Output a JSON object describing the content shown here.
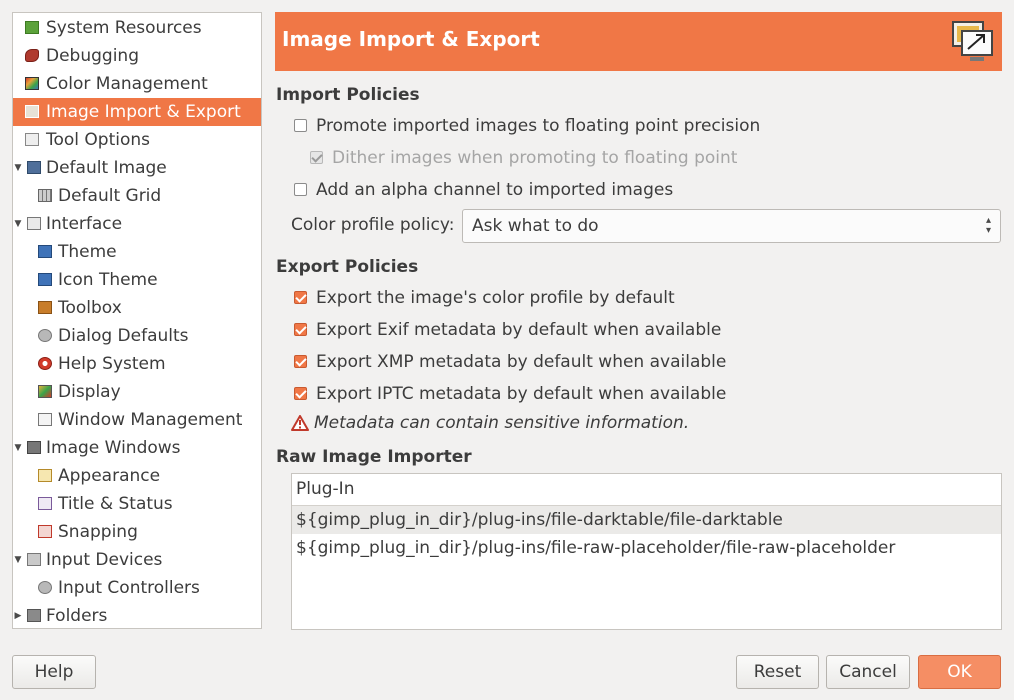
{
  "sidebar": {
    "items": [
      {
        "label": "System Resources",
        "icon": "system-resources-icon",
        "color": "#5ba23a"
      },
      {
        "label": "Debugging",
        "icon": "bug-icon",
        "color": "#b03a2e"
      },
      {
        "label": "Color Management",
        "icon": "color-management-icon",
        "color": "#e8a33b"
      },
      {
        "label": "Image Import & Export",
        "icon": "image-import-export-icon",
        "color": "#8a8a8a"
      },
      {
        "label": "Tool Options",
        "icon": "tool-options-icon",
        "color": "#9a9a9a"
      },
      {
        "label": "Default Image",
        "icon": "default-image-icon",
        "color": "#4f6f9a"
      },
      {
        "label": "Default Grid",
        "icon": "grid-icon",
        "color": "#7d7d7d"
      },
      {
        "label": "Interface",
        "icon": "interface-icon",
        "color": "#8a8a8a"
      },
      {
        "label": "Theme",
        "icon": "theme-icon",
        "color": "#3f73b8"
      },
      {
        "label": "Icon Theme",
        "icon": "icon-theme-icon",
        "color": "#3f73b8"
      },
      {
        "label": "Toolbox",
        "icon": "toolbox-icon",
        "color": "#c87d2a"
      },
      {
        "label": "Dialog Defaults",
        "icon": "dialog-defaults-icon",
        "color": "#9a9a9a"
      },
      {
        "label": "Help System",
        "icon": "lifebuoy-icon",
        "color": "#d23b2b"
      },
      {
        "label": "Display",
        "icon": "display-icon",
        "color": "#e3b23c"
      },
      {
        "label": "Window Management",
        "icon": "window-management-icon",
        "color": "#8a8a8a"
      },
      {
        "label": "Image Windows",
        "icon": "image-windows-icon",
        "color": "#777777"
      },
      {
        "label": "Appearance",
        "icon": "appearance-icon",
        "color": "#e3b23c"
      },
      {
        "label": "Title & Status",
        "icon": "title-status-icon",
        "color": "#7a5a9a"
      },
      {
        "label": "Snapping",
        "icon": "snapping-icon",
        "color": "#c0392b"
      },
      {
        "label": "Input Devices",
        "icon": "input-devices-icon",
        "color": "#8a8a8a"
      },
      {
        "label": "Input Controllers",
        "icon": "input-controllers-icon",
        "color": "#9a9a9a"
      },
      {
        "label": "Folders",
        "icon": "folders-icon",
        "color": "#6b6b6b"
      }
    ]
  },
  "header": {
    "title": "Image Import & Export",
    "icon": "import-export-icon"
  },
  "import": {
    "title": "Import Policies",
    "promote_label": "Promote imported images to floating point precision",
    "promote_checked": false,
    "dither_label": "Dither images when promoting to floating point",
    "dither_checked": true,
    "alpha_label": "Add an alpha channel to imported images",
    "alpha_checked": false,
    "profile_policy_label": "Color profile policy:",
    "profile_policy_value": "Ask what to do"
  },
  "export": {
    "title": "Export Policies",
    "options": [
      {
        "label": "Export the image's color profile by default",
        "checked": true
      },
      {
        "label": "Export Exif metadata by default when available",
        "checked": true
      },
      {
        "label": "Export XMP metadata by default when available",
        "checked": true
      },
      {
        "label": "Export IPTC metadata by default when available",
        "checked": true
      }
    ],
    "warning": "Metadata can contain sensitive information."
  },
  "raw": {
    "title": "Raw Image Importer",
    "column": "Plug-In",
    "rows": [
      "${gimp_plug_in_dir}/plug-ins/file-darktable/file-darktable",
      "${gimp_plug_in_dir}/plug-ins/file-raw-placeholder/file-raw-placeholder"
    ]
  },
  "buttons": {
    "help": "Help",
    "reset": "Reset",
    "cancel": "Cancel",
    "ok": "OK"
  },
  "colors": {
    "accent": "#f07746",
    "warning": "#c0392b"
  }
}
